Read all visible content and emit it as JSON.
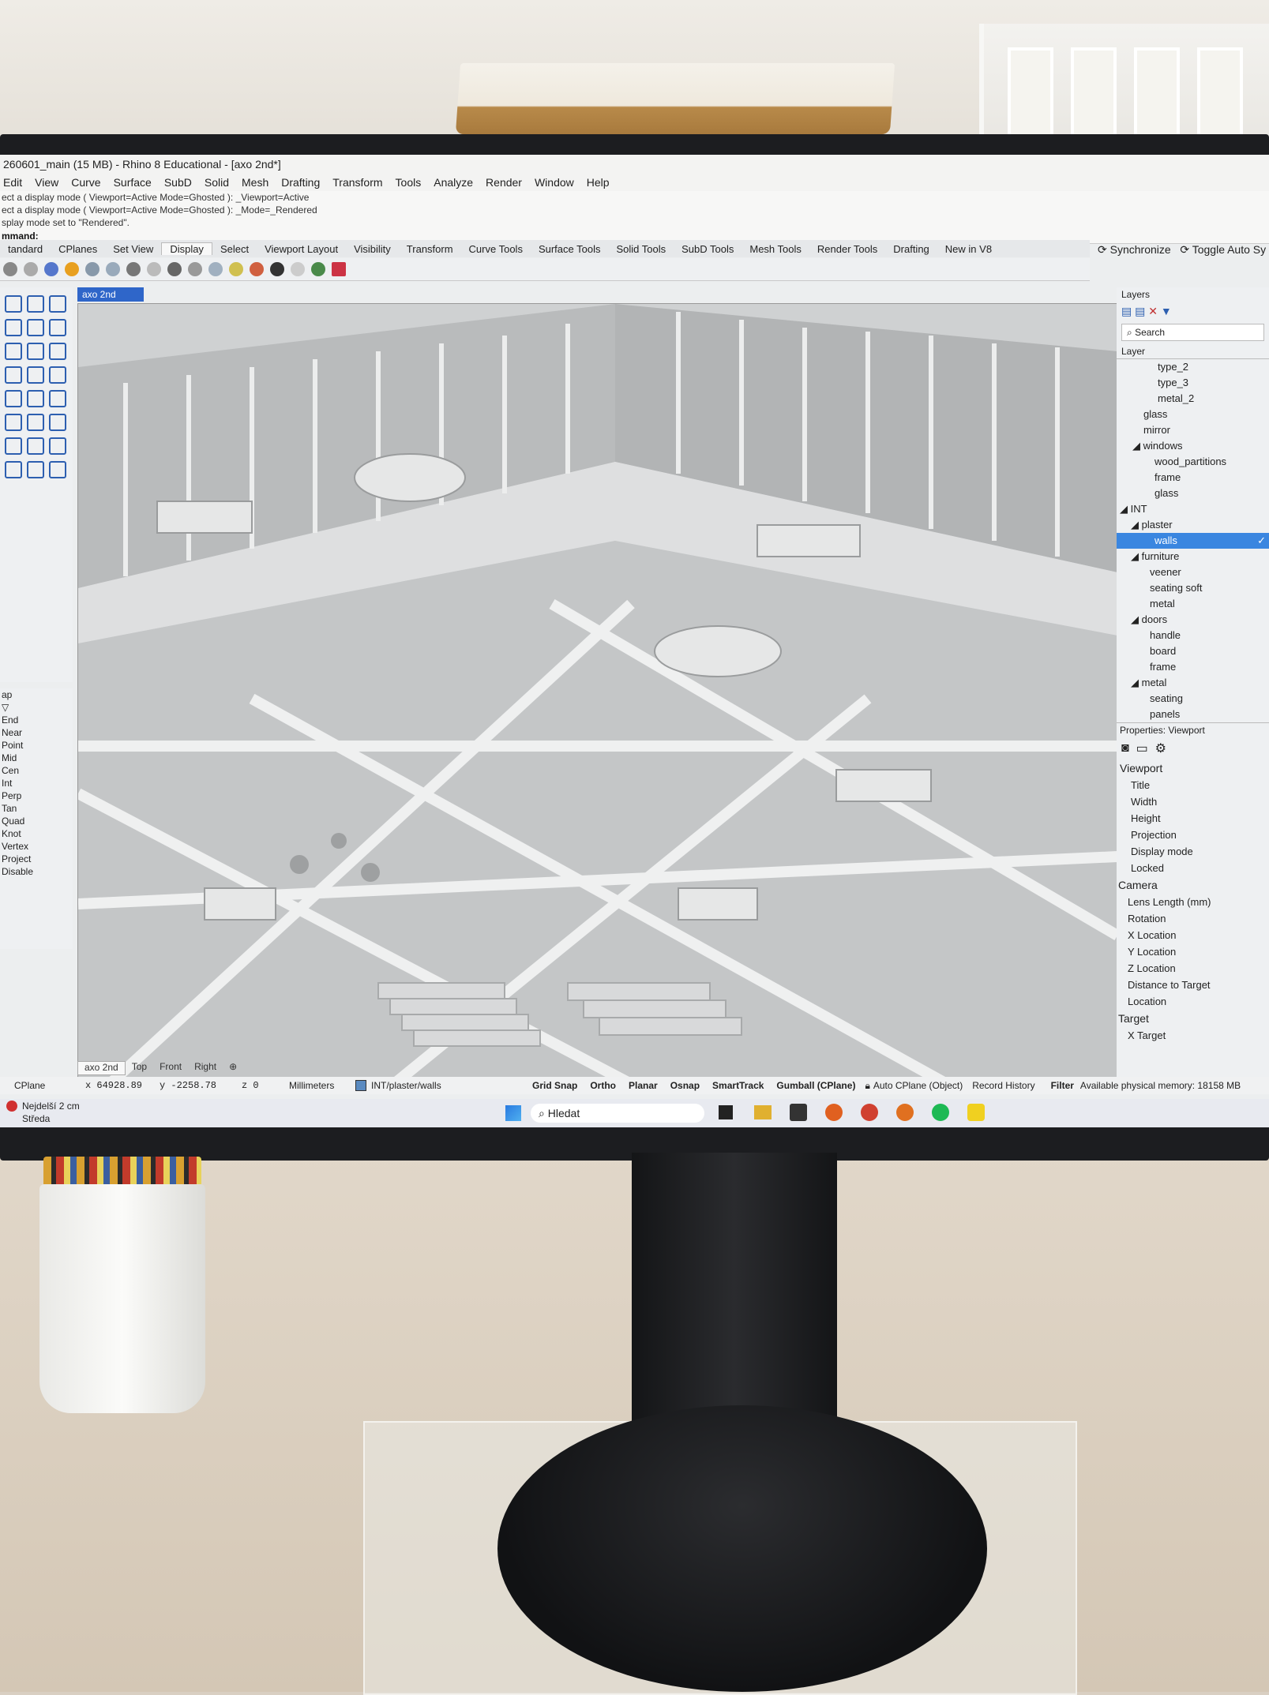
{
  "window": {
    "title": "260601_main (15 MB) - Rhino 8 Educational - [axo 2nd*]",
    "menu": [
      "Edit",
      "View",
      "Curve",
      "Surface",
      "SubD",
      "Solid",
      "Mesh",
      "Drafting",
      "Transform",
      "Tools",
      "Analyze",
      "Render",
      "Window",
      "Help"
    ]
  },
  "command_history": [
    "ect a display mode ( Viewport=Active  Mode=Ghosted ): _Viewport=Active",
    "ect a display mode ( Viewport=Active  Mode=Ghosted ): _Mode=_Rendered",
    "splay mode set to \"Rendered\"."
  ],
  "command_prompt": "mmand:",
  "toolbar_tabs": [
    "tandard",
    "CPlanes",
    "Set View",
    "Display",
    "Select",
    "Viewport Layout",
    "Visibility",
    "Transform",
    "Curve Tools",
    "Surface Tools",
    "Solid Tools",
    "SubD Tools",
    "Mesh Tools",
    "Render Tools",
    "Drafting",
    "New in V8"
  ],
  "toolbar_active": "Display",
  "top_right": {
    "sync": "Synchronize",
    "toggle": "Toggle Auto Sy"
  },
  "viewport": {
    "active_tab": "axo 2nd",
    "bottom_tabs": [
      "axo 2nd",
      "Top",
      "Front",
      "Right"
    ]
  },
  "osnap": {
    "label": "ap",
    "items": [
      "End",
      "Near",
      "Point",
      "Mid",
      "Cen",
      "Int",
      "Perp",
      "Tan",
      "Quad",
      "Knot",
      "Vertex",
      "Project",
      "Disable"
    ]
  },
  "layers_panel": {
    "title": "Layers",
    "search_placeholder": "Search",
    "column": "Layer",
    "items": [
      {
        "name": "type_2",
        "indent": 3
      },
      {
        "name": "type_3",
        "indent": 3
      },
      {
        "name": "metal_2",
        "indent": 3
      },
      {
        "name": "glass",
        "indent": 2
      },
      {
        "name": "mirror",
        "indent": 2
      },
      {
        "name": "windows",
        "indent": 2,
        "expanded": true
      },
      {
        "name": "wood_partitions",
        "indent": 3
      },
      {
        "name": "frame",
        "indent": 3
      },
      {
        "name": "glass",
        "indent": 3
      },
      {
        "name": "INT",
        "indent": 0,
        "expanded": true
      },
      {
        "name": "plaster",
        "indent": 1,
        "expanded": true
      },
      {
        "name": "walls",
        "indent": 2,
        "selected": true
      },
      {
        "name": "furniture",
        "indent": 1,
        "expanded": true
      },
      {
        "name": "veener",
        "indent": 2
      },
      {
        "name": "seating soft",
        "indent": 2
      },
      {
        "name": "metal",
        "indent": 2
      },
      {
        "name": "doors",
        "indent": 1,
        "expanded": true
      },
      {
        "name": "handle",
        "indent": 2
      },
      {
        "name": "board",
        "indent": 2
      },
      {
        "name": "frame",
        "indent": 2
      },
      {
        "name": "metal",
        "indent": 1,
        "expanded": true
      },
      {
        "name": "seating",
        "indent": 2
      },
      {
        "name": "panels",
        "indent": 2
      }
    ]
  },
  "properties_panel": {
    "title": "Properties: Viewport",
    "viewport_section": "Viewport",
    "viewport_fields": [
      "Title",
      "Width",
      "Height",
      "Projection",
      "Display mode",
      "Locked"
    ],
    "camera_section": "Camera",
    "camera_fields": [
      "Lens Length (mm)",
      "Rotation",
      "X Location",
      "Y Location",
      "Z Location",
      "Distance to Target",
      "Location"
    ],
    "target_section": "Target",
    "target_fields": [
      "X Target"
    ]
  },
  "status": {
    "cplane": "CPlane",
    "x": "x 64928.89",
    "y": "y -2258.78",
    "z": "z 0",
    "units": "Millimeters",
    "layer": "INT/plaster/walls",
    "toggles": [
      "Grid Snap",
      "Ortho",
      "Planar",
      "Osnap",
      "SmartTrack",
      "Gumball (CPlane)"
    ],
    "autocplane": "Auto CPlane (Object)",
    "record_history": "Record History",
    "filter": "Filter",
    "memory": "Available physical memory: 18158 MB"
  },
  "taskbar": {
    "date_line1": "Nejdelší 2 cm",
    "date_line2": "Středa",
    "search_placeholder": "Hledat"
  },
  "colors": {
    "accent": "#2f66c9",
    "selection": "#3a86e0",
    "notification": "#d03030"
  }
}
